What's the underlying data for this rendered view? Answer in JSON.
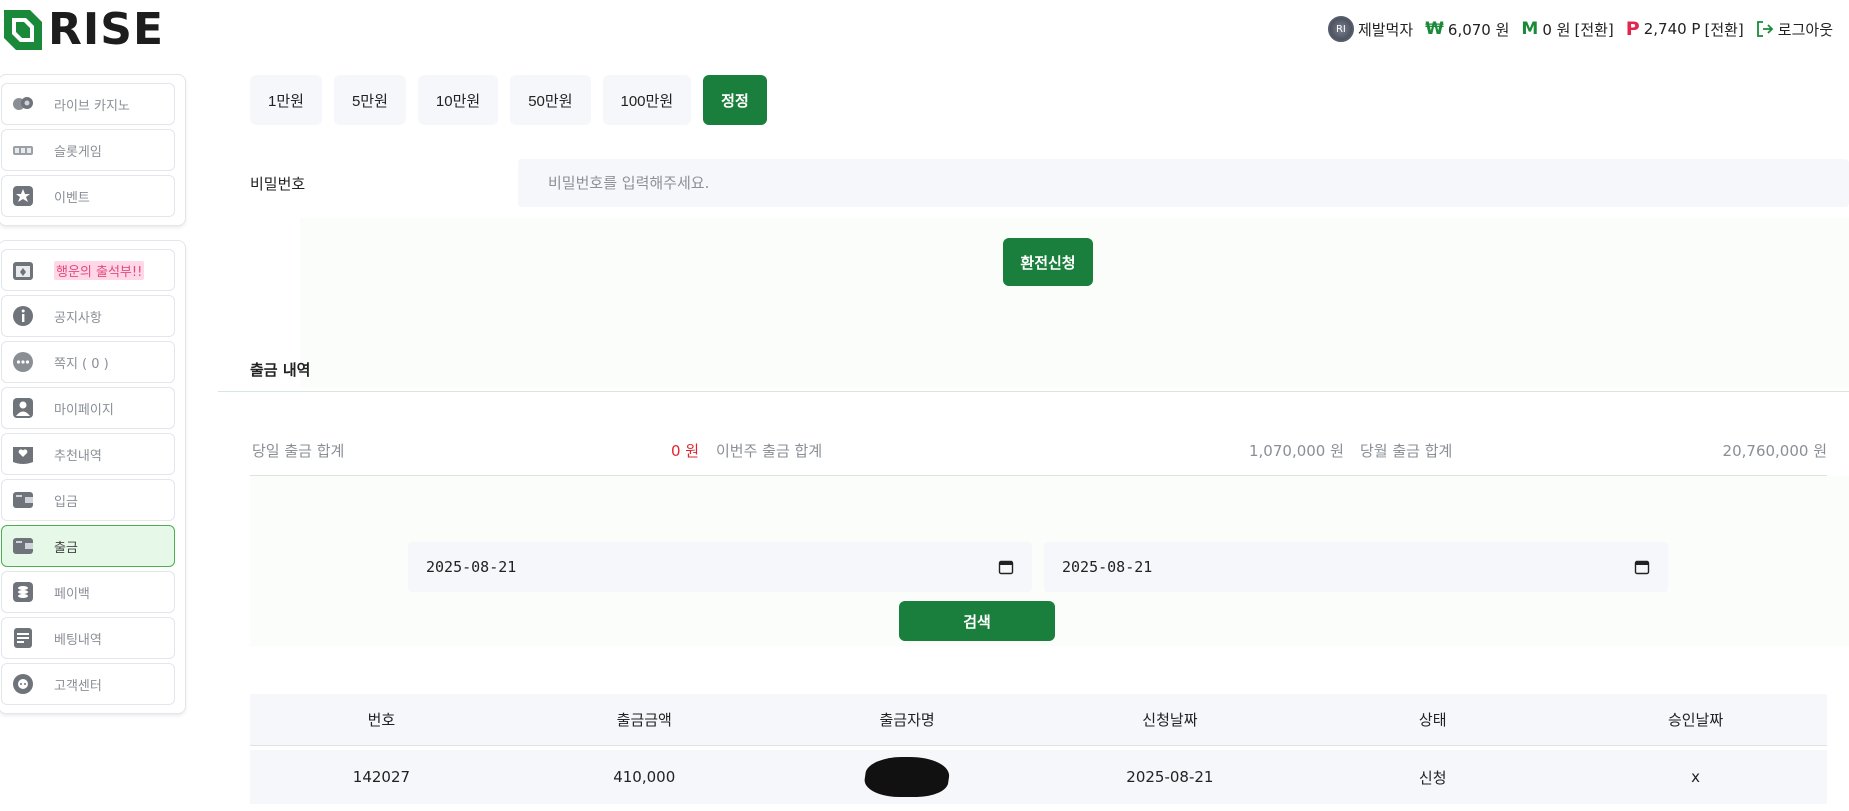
{
  "header": {
    "logo_text": "RISE",
    "badge_text": "RI",
    "username": "제발먹자",
    "won_symbol": "₩",
    "won_balance": "6,070 원",
    "m_symbol": "M",
    "m_balance": "0 원",
    "m_convert": "[전환]",
    "p_symbol": "P",
    "p_balance": "2,740 P",
    "p_convert": "[전환]",
    "logout": "로그아웃"
  },
  "sidebar": {
    "group1": [
      {
        "label": "라이브 카지노",
        "icon": "casino-chips-icon"
      },
      {
        "label": "슬롯게임",
        "icon": "slot-machine-icon"
      },
      {
        "label": "이벤트",
        "icon": "star-badge-icon"
      }
    ],
    "group2": [
      {
        "label": "행운의 출석부!!",
        "icon": "attendance-calendar-icon"
      },
      {
        "label": "공지사항",
        "icon": "info-icon"
      },
      {
        "label": "쪽지 ( 0 )",
        "icon": "message-icon"
      },
      {
        "label": "마이페이지",
        "icon": "user-icon"
      },
      {
        "label": "추천내역",
        "icon": "heart-inbox-icon"
      },
      {
        "label": "입금",
        "icon": "wallet-in-icon"
      },
      {
        "label": "출금",
        "icon": "wallet-out-icon"
      },
      {
        "label": "페이백",
        "icon": "coins-icon"
      },
      {
        "label": "베팅내역",
        "icon": "clipboard-icon"
      },
      {
        "label": "고객센터",
        "icon": "support-icon"
      }
    ]
  },
  "amounts": [
    "1만원",
    "5만원",
    "10만원",
    "50만원",
    "100만원"
  ],
  "amount_reset": "정정",
  "password": {
    "label": "비밀번호",
    "placeholder": "비밀번호를 입력해주세요."
  },
  "apply_button": "환전신청",
  "history": {
    "title": "출금 내역",
    "daily_label": "당일 출금 합계",
    "daily_value": "0 원",
    "weekly_label": "이번주 출금 합계",
    "weekly_value": "1,070,000 원",
    "monthly_label": "당월 출금 합계",
    "monthly_value": "20,760,000 원"
  },
  "search": {
    "start_date": "2025-08-21",
    "end_date": "2025-08-21",
    "button": "검색"
  },
  "table": {
    "headers": [
      "번호",
      "출금금액",
      "출금자명",
      "신청날짜",
      "상태",
      "승인날짜"
    ],
    "rows": [
      {
        "id": "142027",
        "amount": "410,000",
        "name": "",
        "date": "2025-08-21",
        "status": "신청",
        "approved": "x"
      }
    ]
  },
  "colors": {
    "primary_green": "#1a7f3c",
    "accent_red": "#e0242e",
    "point_pink": "#e0254e"
  }
}
